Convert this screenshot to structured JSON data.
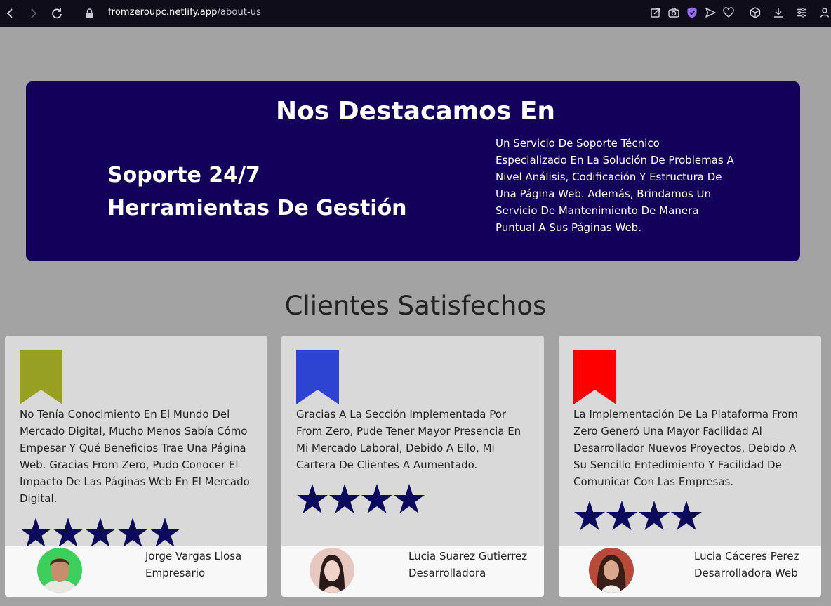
{
  "browser": {
    "url_host": "fromzeroupc.netlify.app",
    "url_path": "/about-us",
    "icons": [
      "back-icon",
      "forward-icon",
      "reload-icon",
      "lock-icon",
      "share-icon",
      "camera-icon",
      "shield-icon",
      "send-icon",
      "heart-icon",
      "cube-icon",
      "download-icon",
      "menu-icon",
      "profile-icon"
    ]
  },
  "feature": {
    "title": "Nos Destacamos En",
    "items": [
      "Soporte 24/7",
      "Herramientas De Gestión"
    ],
    "description": "Un Servicio De Soporte Técnico Especializado En La Solución De Problemas A Nivel Análisis, Codificación Y Estructura De Una Página Web. Además, Brindamos Un Servicio De Mantenimiento De Manera Puntual A Sus Páginas Web.",
    "background": "#12005a"
  },
  "testimonials": {
    "title": "Clientes Satisfechos",
    "cards": [
      {
        "bookmark_color": "#98a024",
        "quote": "No Tenía Conocimiento En El Mundo Del Mercado Digital, Mucho Menos Sabía Cómo Empesar Y Qué Beneficios Trae Una Página Web. Gracias From Zero, Pudo Conocer El Impacto De Las Páginas Web En El Mercado Digital.",
        "rating": 5,
        "name": "Jorge Vargas Llosa",
        "role": "Empresario"
      },
      {
        "bookmark_color": "#2d44d2",
        "quote": "Gracias A La Sección Implementada Por From Zero, Pude Tener Mayor Presencia En Mi Mercado Laboral, Debido A Ello, Mi Cartera De Clientes A Aumentado.",
        "rating": 4,
        "name": "Lucia Suarez Gutierrez",
        "role": "Desarrolladora"
      },
      {
        "bookmark_color": "#ff0000",
        "quote": "La Implementación De La Plataforma From Zero Generó Una Mayor Facilidad Al Desarrollador Nuevos Proyectos, Debido A Su Sencillo Entedimiento Y Facilidad De Comunicar Con Las Empresas.",
        "rating": 4,
        "name": "Lucia Cáceres Perez",
        "role": "Desarrolladora Web"
      }
    ],
    "star_color": "#0c0a5c"
  }
}
